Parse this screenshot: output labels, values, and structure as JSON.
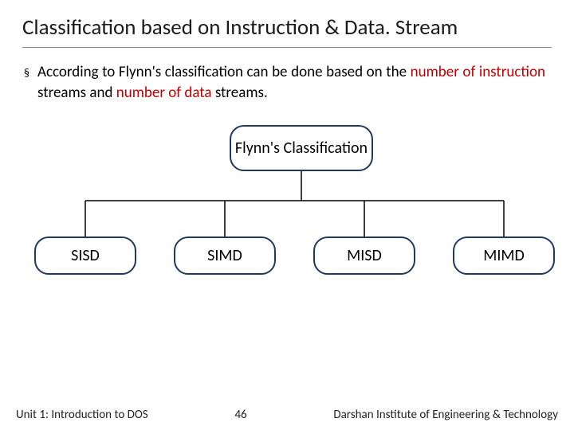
{
  "title": "Classification based on Instruction & Data. Stream",
  "bullet": {
    "pre": "According to Flynn's classification can be done based on the ",
    "red1": "number of instruction",
    "mid": " streams and ",
    "red2": "number of data",
    "post": " streams."
  },
  "diagram": {
    "root": "Flynn's Classification",
    "leaves": [
      "SISD",
      "SIMD",
      "MISD",
      "MIMD"
    ]
  },
  "footer": {
    "left": "Unit 1: Introduction to DOS",
    "center": "46",
    "right": "Darshan Institute of Engineering & Technology"
  },
  "colors": {
    "node_border": "#203864",
    "accent_text": "#c00000"
  }
}
